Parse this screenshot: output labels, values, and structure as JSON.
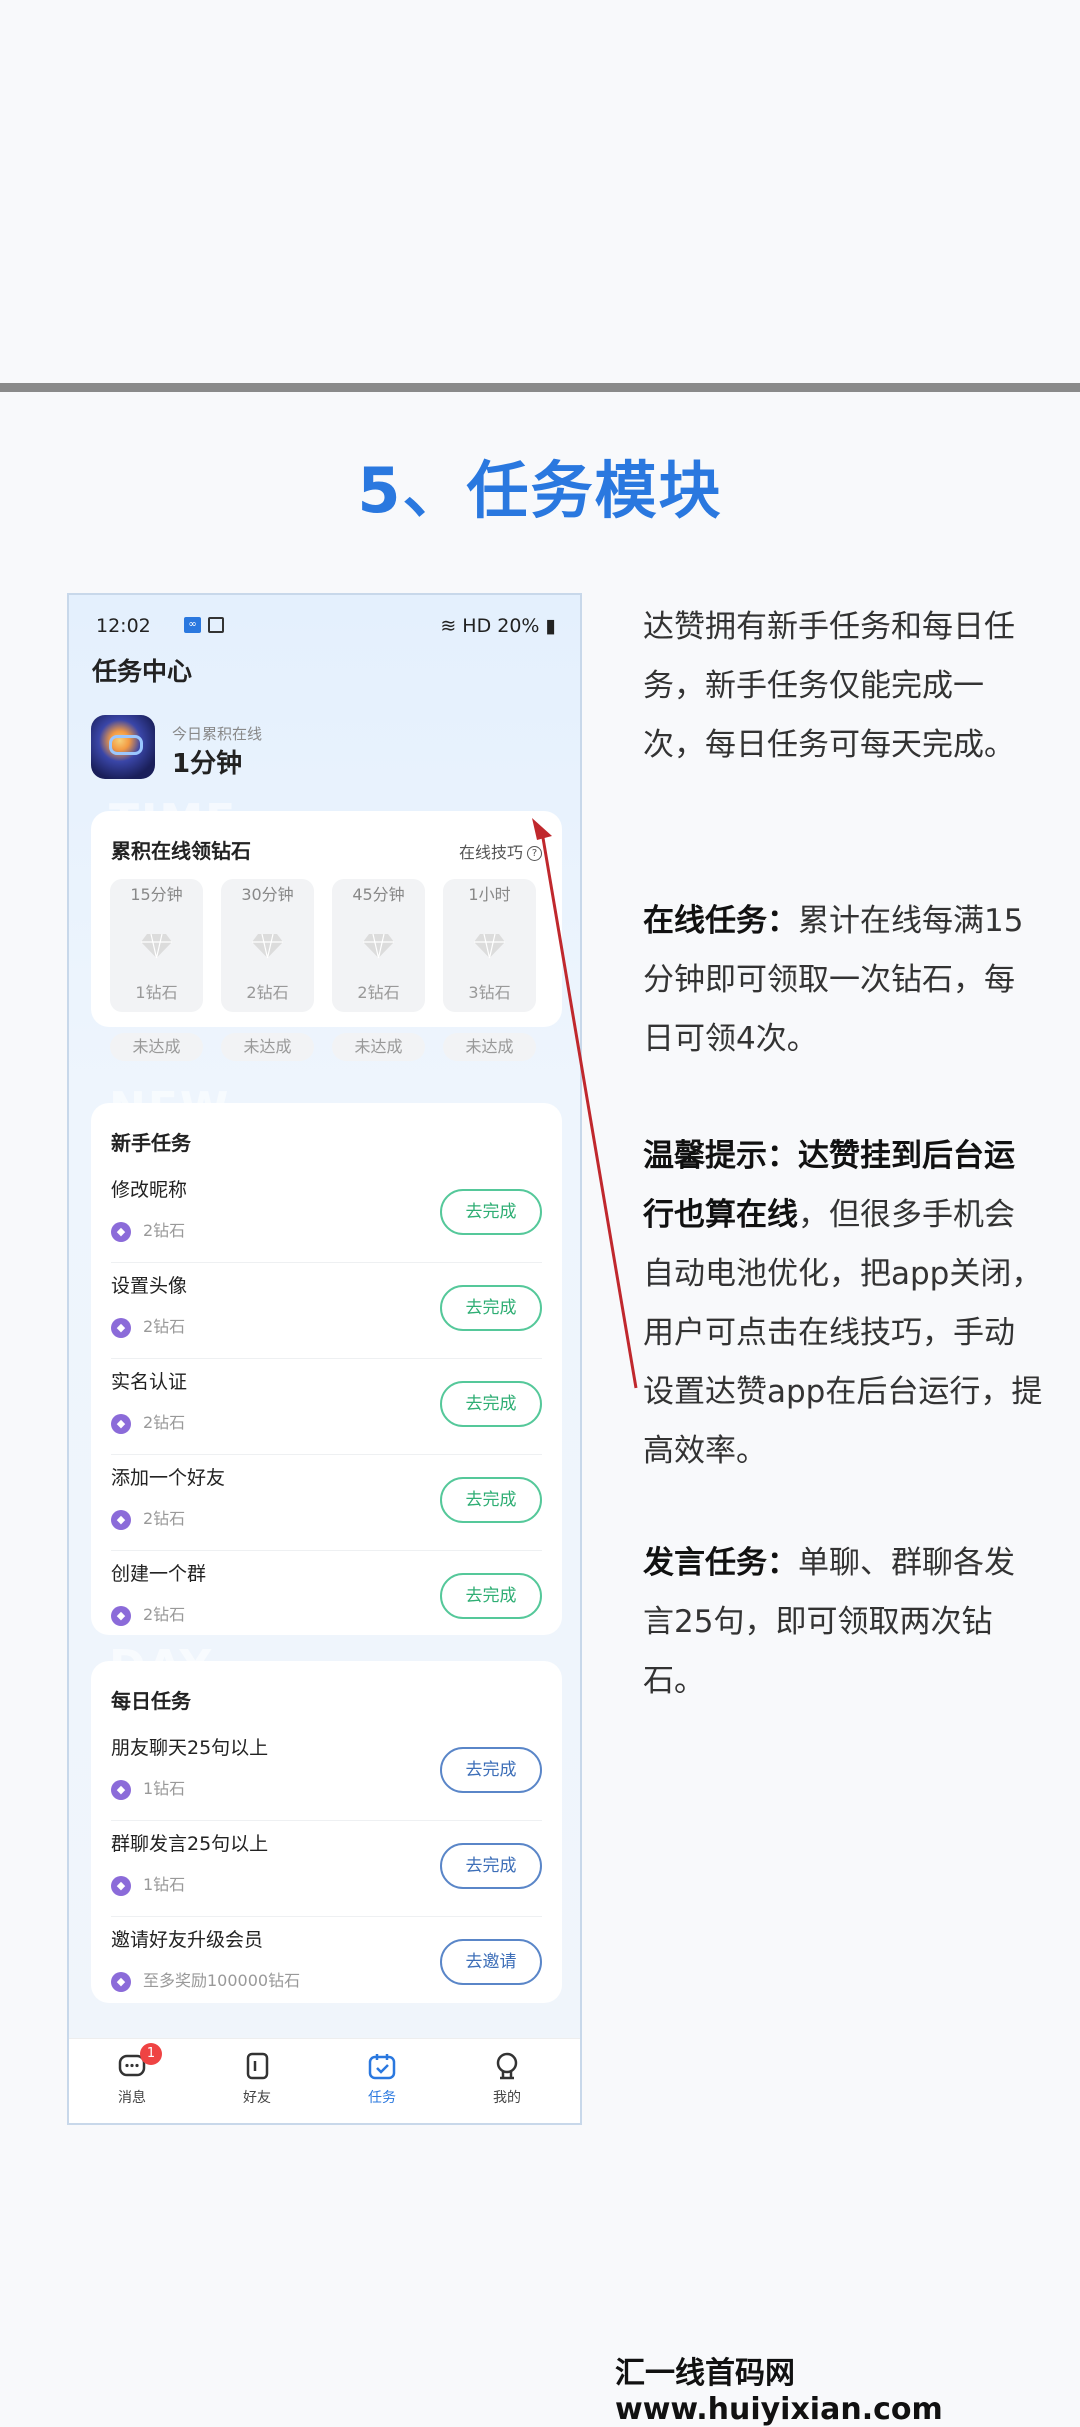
{
  "heading": "5、任务模块",
  "phone": {
    "status": {
      "time": "12:02",
      "right": "HD 20%"
    },
    "title": "任务中心",
    "online": {
      "label": "今日累积在线",
      "value": "1分钟"
    },
    "online_card": {
      "watermark": "TIME",
      "title": "累积在线领钻石",
      "tips": "在线技巧",
      "slots": [
        {
          "time": "15分钟",
          "reward": "1钻石",
          "status": "未达成"
        },
        {
          "time": "30分钟",
          "reward": "2钻石",
          "status": "未达成"
        },
        {
          "time": "45分钟",
          "reward": "2钻石",
          "status": "未达成"
        },
        {
          "time": "1小时",
          "reward": "3钻石",
          "status": "未达成"
        }
      ]
    },
    "newbie": {
      "watermark": "NEW",
      "title": "新手任务",
      "tasks": [
        {
          "name": "修改昵称",
          "reward": "2钻石",
          "button": "去完成"
        },
        {
          "name": "设置头像",
          "reward": "2钻石",
          "button": "去完成"
        },
        {
          "name": "实名认证",
          "reward": "2钻石",
          "button": "去完成"
        },
        {
          "name": "添加一个好友",
          "reward": "2钻石",
          "button": "去完成"
        },
        {
          "name": "创建一个群",
          "reward": "2钻石",
          "button": "去完成"
        }
      ]
    },
    "daily": {
      "watermark": "DAY",
      "title": "每日任务",
      "tasks": [
        {
          "name": "朋友聊天25句以上",
          "reward": "1钻石",
          "button": "去完成"
        },
        {
          "name": "群聊发言25句以上",
          "reward": "1钻石",
          "button": "去完成"
        },
        {
          "name": "邀请好友升级会员",
          "reward": "至多奖励100000钻石",
          "button": "去邀请"
        }
      ]
    },
    "tabs": [
      {
        "label": "消息",
        "badge": "1"
      },
      {
        "label": "好友"
      },
      {
        "label": "任务"
      },
      {
        "label": "我的"
      }
    ]
  },
  "desc": {
    "p1": "达赞拥有新手任务和每日任务，新手任务仅能完成一次，每日任务可每天完成。",
    "p2_label": "在线任务：",
    "p2_text": "累计在线每满15分钟即可领取一次钻石，每日可领4次。",
    "p3_label": "温馨提示：",
    "p3_bold": "达赞挂到后台运行也算在线",
    "p3_text": "，但很多手机会自动电池优化，把app关闭，用户可点击在线技巧，手动设置达赞app在后台运行，提高效率。",
    "p4_label": "发言任务：",
    "p4_text": "单聊、群聊各发言25句，即可领取两次钻石。"
  },
  "footer": "汇一线首码网 www.huiyixian.com",
  "colors": {
    "heading": "#2a78df",
    "green_button": "#2fae74",
    "blue_button": "#3e6fb8",
    "annotation": "#c0282d"
  }
}
